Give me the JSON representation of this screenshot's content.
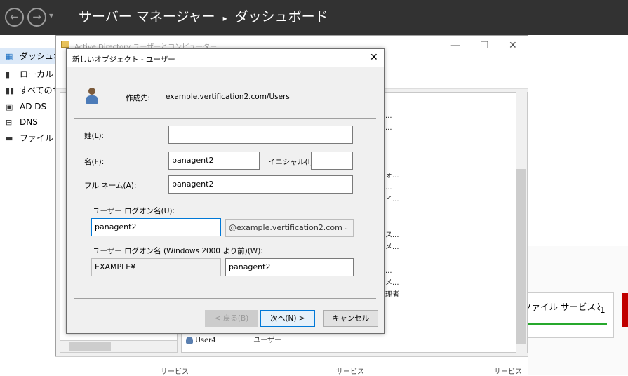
{
  "topbar": {
    "back": "←",
    "forward": "→",
    "dropdown": "▾",
    "breadcrumb_app": "サーバー マネージャー",
    "breadcrumb_sep": "▸",
    "breadcrumb_page": "ダッシュボード"
  },
  "nav": {
    "items": [
      {
        "label": "ダッシュボード",
        "icon": "▦"
      },
      {
        "label": "ローカル サーバー",
        "icon": "▮"
      },
      {
        "label": "すべてのサーバー",
        "icon": "▮▮"
      },
      {
        "label": "AD DS",
        "icon": "▣"
      },
      {
        "label": "DNS",
        "icon": "⊟"
      },
      {
        "label": "ファイル サービスと記憶域",
        "icon": "▬"
      }
    ]
  },
  "aduc": {
    "title": "Active Directory ユーザーとコンピューター",
    "minimize": "—",
    "maximize": "☐",
    "close": "✕",
    "list_fragments": [
      "テ...",
      "コ...",
      "フォ...",
      "エ...",
      "メイ...",
      "アス...",
      "ドメ...",
      "...",
      "ー...",
      "ドメ...",
      "管理者"
    ],
    "row_user": {
      "name": "User4",
      "type": "ユーザー"
    }
  },
  "dialog": {
    "title": "新しいオブジェクト - ユーザー",
    "close": "✕",
    "create_in_label": "作成先:",
    "create_in_value": "example.vertification2.com/Users",
    "last_name": {
      "label": "姓(L):",
      "value": ""
    },
    "first_name": {
      "label": "名(F):",
      "value": "panagent2"
    },
    "initials": {
      "label": "イニシャル(I):",
      "value": ""
    },
    "full_name": {
      "label": "フル ネーム(A):",
      "value": "panagent2"
    },
    "logon": {
      "label": "ユーザー ログオン名(U):",
      "value": "panagent2",
      "domain": "@example.vertification2.com"
    },
    "logon_pre2000": {
      "label": "ユーザー ログオン名 (Windows 2000 より前)(W):",
      "domain": "EXAMPLE¥",
      "value": "panagent2"
    },
    "buttons": {
      "back": "< 戻る(B)",
      "next": "次へ(N) >",
      "cancel": "キャンセル"
    }
  },
  "tile": {
    "title": "ファイル サービスと記憶域",
    "count": "1"
  },
  "footer": {
    "col1": "サービス",
    "col2": "サービス",
    "col3": "サービス"
  },
  "colors": {
    "topbar": "#323232",
    "accent": "#0078d7",
    "green": "#26a82c",
    "red": "#c00000"
  }
}
